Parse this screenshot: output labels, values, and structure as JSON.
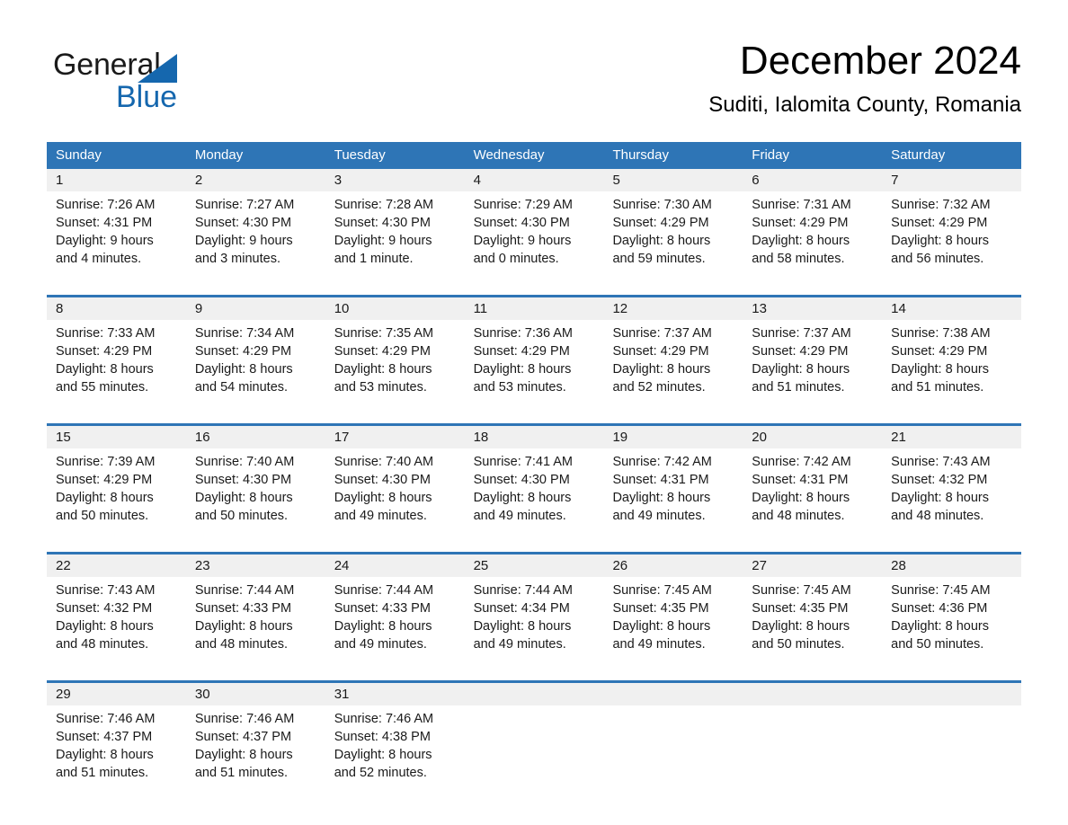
{
  "brand": {
    "name_part1": "General",
    "name_part2": "Blue",
    "accent_color": "#1567ae",
    "triangle_icon": "brand-triangle-icon"
  },
  "header": {
    "title": "December 2024",
    "subtitle": "Suditi, Ialomita County, Romania"
  },
  "theme": {
    "header_blue": "#2e75b6",
    "daynum_band_gray": "#f0f0f0",
    "text_black": "#1a1a1a"
  },
  "weekdays": [
    "Sunday",
    "Monday",
    "Tuesday",
    "Wednesday",
    "Thursday",
    "Friday",
    "Saturday"
  ],
  "weeks": [
    {
      "days": [
        {
          "num": "1",
          "sunrise": "Sunrise: 7:26 AM",
          "sunset": "Sunset: 4:31 PM",
          "daylight_1": "Daylight: 9 hours",
          "daylight_2": "and 4 minutes."
        },
        {
          "num": "2",
          "sunrise": "Sunrise: 7:27 AM",
          "sunset": "Sunset: 4:30 PM",
          "daylight_1": "Daylight: 9 hours",
          "daylight_2": "and 3 minutes."
        },
        {
          "num": "3",
          "sunrise": "Sunrise: 7:28 AM",
          "sunset": "Sunset: 4:30 PM",
          "daylight_1": "Daylight: 9 hours",
          "daylight_2": "and 1 minute."
        },
        {
          "num": "4",
          "sunrise": "Sunrise: 7:29 AM",
          "sunset": "Sunset: 4:30 PM",
          "daylight_1": "Daylight: 9 hours",
          "daylight_2": "and 0 minutes."
        },
        {
          "num": "5",
          "sunrise": "Sunrise: 7:30 AM",
          "sunset": "Sunset: 4:29 PM",
          "daylight_1": "Daylight: 8 hours",
          "daylight_2": "and 59 minutes."
        },
        {
          "num": "6",
          "sunrise": "Sunrise: 7:31 AM",
          "sunset": "Sunset: 4:29 PM",
          "daylight_1": "Daylight: 8 hours",
          "daylight_2": "and 58 minutes."
        },
        {
          "num": "7",
          "sunrise": "Sunrise: 7:32 AM",
          "sunset": "Sunset: 4:29 PM",
          "daylight_1": "Daylight: 8 hours",
          "daylight_2": "and 56 minutes."
        }
      ]
    },
    {
      "days": [
        {
          "num": "8",
          "sunrise": "Sunrise: 7:33 AM",
          "sunset": "Sunset: 4:29 PM",
          "daylight_1": "Daylight: 8 hours",
          "daylight_2": "and 55 minutes."
        },
        {
          "num": "9",
          "sunrise": "Sunrise: 7:34 AM",
          "sunset": "Sunset: 4:29 PM",
          "daylight_1": "Daylight: 8 hours",
          "daylight_2": "and 54 minutes."
        },
        {
          "num": "10",
          "sunrise": "Sunrise: 7:35 AM",
          "sunset": "Sunset: 4:29 PM",
          "daylight_1": "Daylight: 8 hours",
          "daylight_2": "and 53 minutes."
        },
        {
          "num": "11",
          "sunrise": "Sunrise: 7:36 AM",
          "sunset": "Sunset: 4:29 PM",
          "daylight_1": "Daylight: 8 hours",
          "daylight_2": "and 53 minutes."
        },
        {
          "num": "12",
          "sunrise": "Sunrise: 7:37 AM",
          "sunset": "Sunset: 4:29 PM",
          "daylight_1": "Daylight: 8 hours",
          "daylight_2": "and 52 minutes."
        },
        {
          "num": "13",
          "sunrise": "Sunrise: 7:37 AM",
          "sunset": "Sunset: 4:29 PM",
          "daylight_1": "Daylight: 8 hours",
          "daylight_2": "and 51 minutes."
        },
        {
          "num": "14",
          "sunrise": "Sunrise: 7:38 AM",
          "sunset": "Sunset: 4:29 PM",
          "daylight_1": "Daylight: 8 hours",
          "daylight_2": "and 51 minutes."
        }
      ]
    },
    {
      "days": [
        {
          "num": "15",
          "sunrise": "Sunrise: 7:39 AM",
          "sunset": "Sunset: 4:29 PM",
          "daylight_1": "Daylight: 8 hours",
          "daylight_2": "and 50 minutes."
        },
        {
          "num": "16",
          "sunrise": "Sunrise: 7:40 AM",
          "sunset": "Sunset: 4:30 PM",
          "daylight_1": "Daylight: 8 hours",
          "daylight_2": "and 50 minutes."
        },
        {
          "num": "17",
          "sunrise": "Sunrise: 7:40 AM",
          "sunset": "Sunset: 4:30 PM",
          "daylight_1": "Daylight: 8 hours",
          "daylight_2": "and 49 minutes."
        },
        {
          "num": "18",
          "sunrise": "Sunrise: 7:41 AM",
          "sunset": "Sunset: 4:30 PM",
          "daylight_1": "Daylight: 8 hours",
          "daylight_2": "and 49 minutes."
        },
        {
          "num": "19",
          "sunrise": "Sunrise: 7:42 AM",
          "sunset": "Sunset: 4:31 PM",
          "daylight_1": "Daylight: 8 hours",
          "daylight_2": "and 49 minutes."
        },
        {
          "num": "20",
          "sunrise": "Sunrise: 7:42 AM",
          "sunset": "Sunset: 4:31 PM",
          "daylight_1": "Daylight: 8 hours",
          "daylight_2": "and 48 minutes."
        },
        {
          "num": "21",
          "sunrise": "Sunrise: 7:43 AM",
          "sunset": "Sunset: 4:32 PM",
          "daylight_1": "Daylight: 8 hours",
          "daylight_2": "and 48 minutes."
        }
      ]
    },
    {
      "days": [
        {
          "num": "22",
          "sunrise": "Sunrise: 7:43 AM",
          "sunset": "Sunset: 4:32 PM",
          "daylight_1": "Daylight: 8 hours",
          "daylight_2": "and 48 minutes."
        },
        {
          "num": "23",
          "sunrise": "Sunrise: 7:44 AM",
          "sunset": "Sunset: 4:33 PM",
          "daylight_1": "Daylight: 8 hours",
          "daylight_2": "and 48 minutes."
        },
        {
          "num": "24",
          "sunrise": "Sunrise: 7:44 AM",
          "sunset": "Sunset: 4:33 PM",
          "daylight_1": "Daylight: 8 hours",
          "daylight_2": "and 49 minutes."
        },
        {
          "num": "25",
          "sunrise": "Sunrise: 7:44 AM",
          "sunset": "Sunset: 4:34 PM",
          "daylight_1": "Daylight: 8 hours",
          "daylight_2": "and 49 minutes."
        },
        {
          "num": "26",
          "sunrise": "Sunrise: 7:45 AM",
          "sunset": "Sunset: 4:35 PM",
          "daylight_1": "Daylight: 8 hours",
          "daylight_2": "and 49 minutes."
        },
        {
          "num": "27",
          "sunrise": "Sunrise: 7:45 AM",
          "sunset": "Sunset: 4:35 PM",
          "daylight_1": "Daylight: 8 hours",
          "daylight_2": "and 50 minutes."
        },
        {
          "num": "28",
          "sunrise": "Sunrise: 7:45 AM",
          "sunset": "Sunset: 4:36 PM",
          "daylight_1": "Daylight: 8 hours",
          "daylight_2": "and 50 minutes."
        }
      ]
    },
    {
      "days": [
        {
          "num": "29",
          "sunrise": "Sunrise: 7:46 AM",
          "sunset": "Sunset: 4:37 PM",
          "daylight_1": "Daylight: 8 hours",
          "daylight_2": "and 51 minutes."
        },
        {
          "num": "30",
          "sunrise": "Sunrise: 7:46 AM",
          "sunset": "Sunset: 4:37 PM",
          "daylight_1": "Daylight: 8 hours",
          "daylight_2": "and 51 minutes."
        },
        {
          "num": "31",
          "sunrise": "Sunrise: 7:46 AM",
          "sunset": "Sunset: 4:38 PM",
          "daylight_1": "Daylight: 8 hours",
          "daylight_2": "and 52 minutes."
        },
        {
          "num": "",
          "sunrise": "",
          "sunset": "",
          "daylight_1": "",
          "daylight_2": ""
        },
        {
          "num": "",
          "sunrise": "",
          "sunset": "",
          "daylight_1": "",
          "daylight_2": ""
        },
        {
          "num": "",
          "sunrise": "",
          "sunset": "",
          "daylight_1": "",
          "daylight_2": ""
        },
        {
          "num": "",
          "sunrise": "",
          "sunset": "",
          "daylight_1": "",
          "daylight_2": ""
        }
      ]
    }
  ]
}
